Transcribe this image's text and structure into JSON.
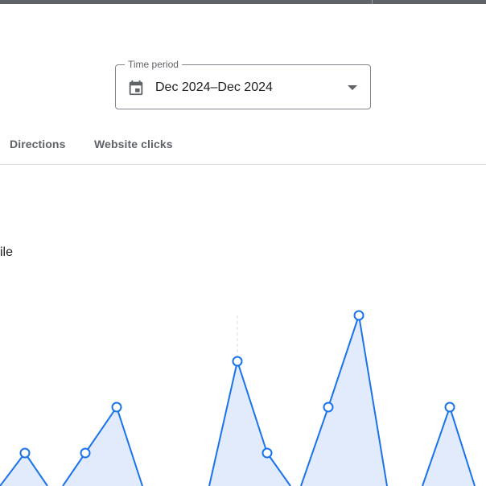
{
  "time_period": {
    "label": "Time period",
    "value": "Dec 2024–Dec 2024"
  },
  "tabs": [
    {
      "label": "Directions"
    },
    {
      "label": "Website clicks"
    }
  ],
  "partial_text": "ile",
  "colors": {
    "accent": "#1a73e8",
    "area_fill": "#e1ebfb",
    "text": "#202124",
    "muted": "#5f6368",
    "divider": "#dadce0"
  },
  "icons": {
    "time_period": "calendar-icon",
    "dropdown": "arrow-drop-down-icon"
  }
}
